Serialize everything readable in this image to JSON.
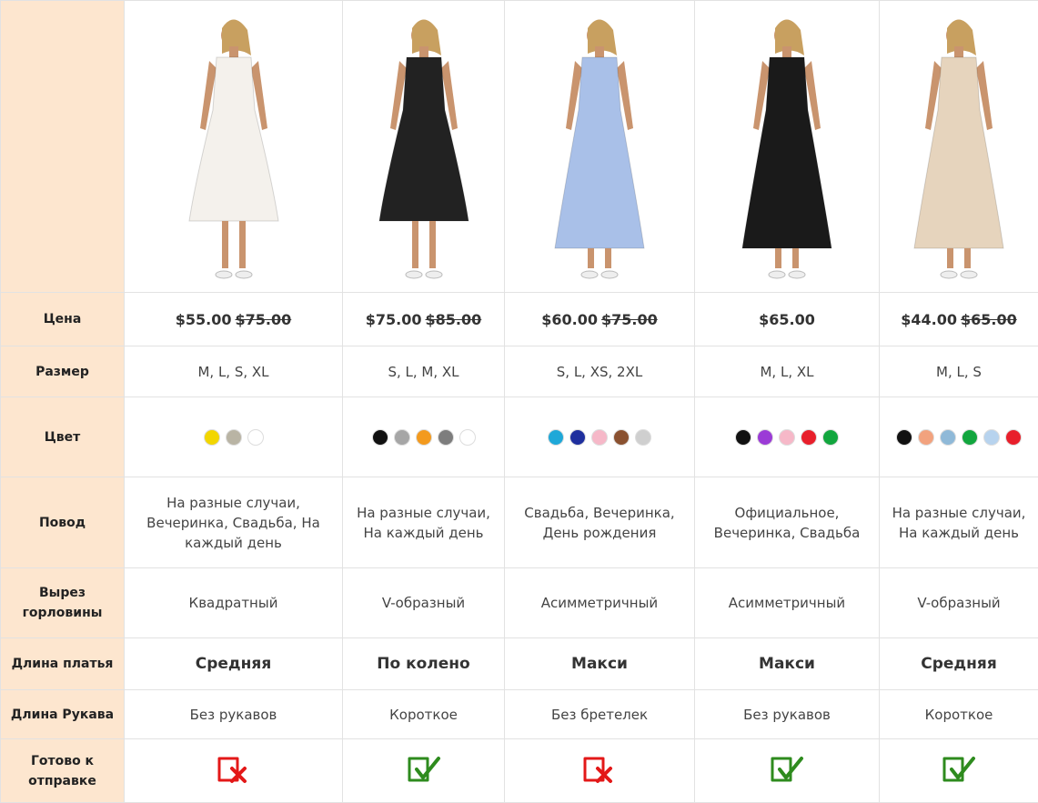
{
  "row_labels": {
    "price": "Цена",
    "size": "Размер",
    "color": "Цвет",
    "occasion": "Повод",
    "neckline": "Вырез горловины",
    "length": "Длина платья",
    "sleeve": "Длина Рукава",
    "ready": "Готово к отправке"
  },
  "products": [
    {
      "dress_color": "#f4f1ec",
      "price": "$55.00",
      "old_price": "$75.00",
      "sizes": "M, L, S, XL",
      "colors": [
        "#f2d600",
        "#b9b4a4",
        "#ffffff"
      ],
      "occasion": "На разные случаи, Вечеринка, Свадьба, На каждый день",
      "neckline": "Квадратный",
      "length": "Средняя",
      "sleeve": "Без рукавов",
      "ready": false
    },
    {
      "dress_color": "#222222",
      "price": "$75.00",
      "old_price": "$85.00",
      "sizes": "S, L, M, XL",
      "colors": [
        "#111111",
        "#a6a6a6",
        "#f39a1e",
        "#7d7d7d",
        "#ffffff"
      ],
      "occasion": "На разные случаи, На каждый день",
      "neckline": "V-образный",
      "length": "По колено",
      "sleeve": "Короткое",
      "ready": true
    },
    {
      "dress_color": "#a9c0e8",
      "price": "$60.00",
      "old_price": "$75.00",
      "sizes": "S, L, XS, 2XL",
      "colors": [
        "#1fa8d8",
        "#1f2f9e",
        "#f6b8c8",
        "#8a5130",
        "#cfcfcf"
      ],
      "occasion": "Свадьба, Вечеринка, День рождения",
      "neckline": "Асимметричный",
      "length": "Макси",
      "sleeve": "Без бретелек",
      "ready": false
    },
    {
      "dress_color": "#1a1a1a",
      "price": "$65.00",
      "old_price": "",
      "sizes": "M, L, XL",
      "colors": [
        "#111111",
        "#9b3bd6",
        "#f6b8c8",
        "#e81f2b",
        "#12a63e"
      ],
      "occasion": "Официальное, Вечеринка, Свадьба",
      "neckline": "Асимметричный",
      "length": "Макси",
      "sleeve": "Без рукавов",
      "ready": true
    },
    {
      "dress_color": "#e6d4bd",
      "price": "$44.00",
      "old_price": "$65.00",
      "sizes": "M, L, S",
      "colors": [
        "#111111",
        "#f2a27e",
        "#8fb9d8",
        "#12a63e",
        "#b7d3ee",
        "#e81f2b"
      ],
      "occasion": "На разные случаи, На каждый день",
      "neckline": "V-образный",
      "length": "Средняя",
      "sleeve": "Короткое",
      "ready": true
    }
  ],
  "accent": {
    "ok": "#2e8b1e",
    "no": "#e31818",
    "label_bg": "#fde6cf"
  }
}
